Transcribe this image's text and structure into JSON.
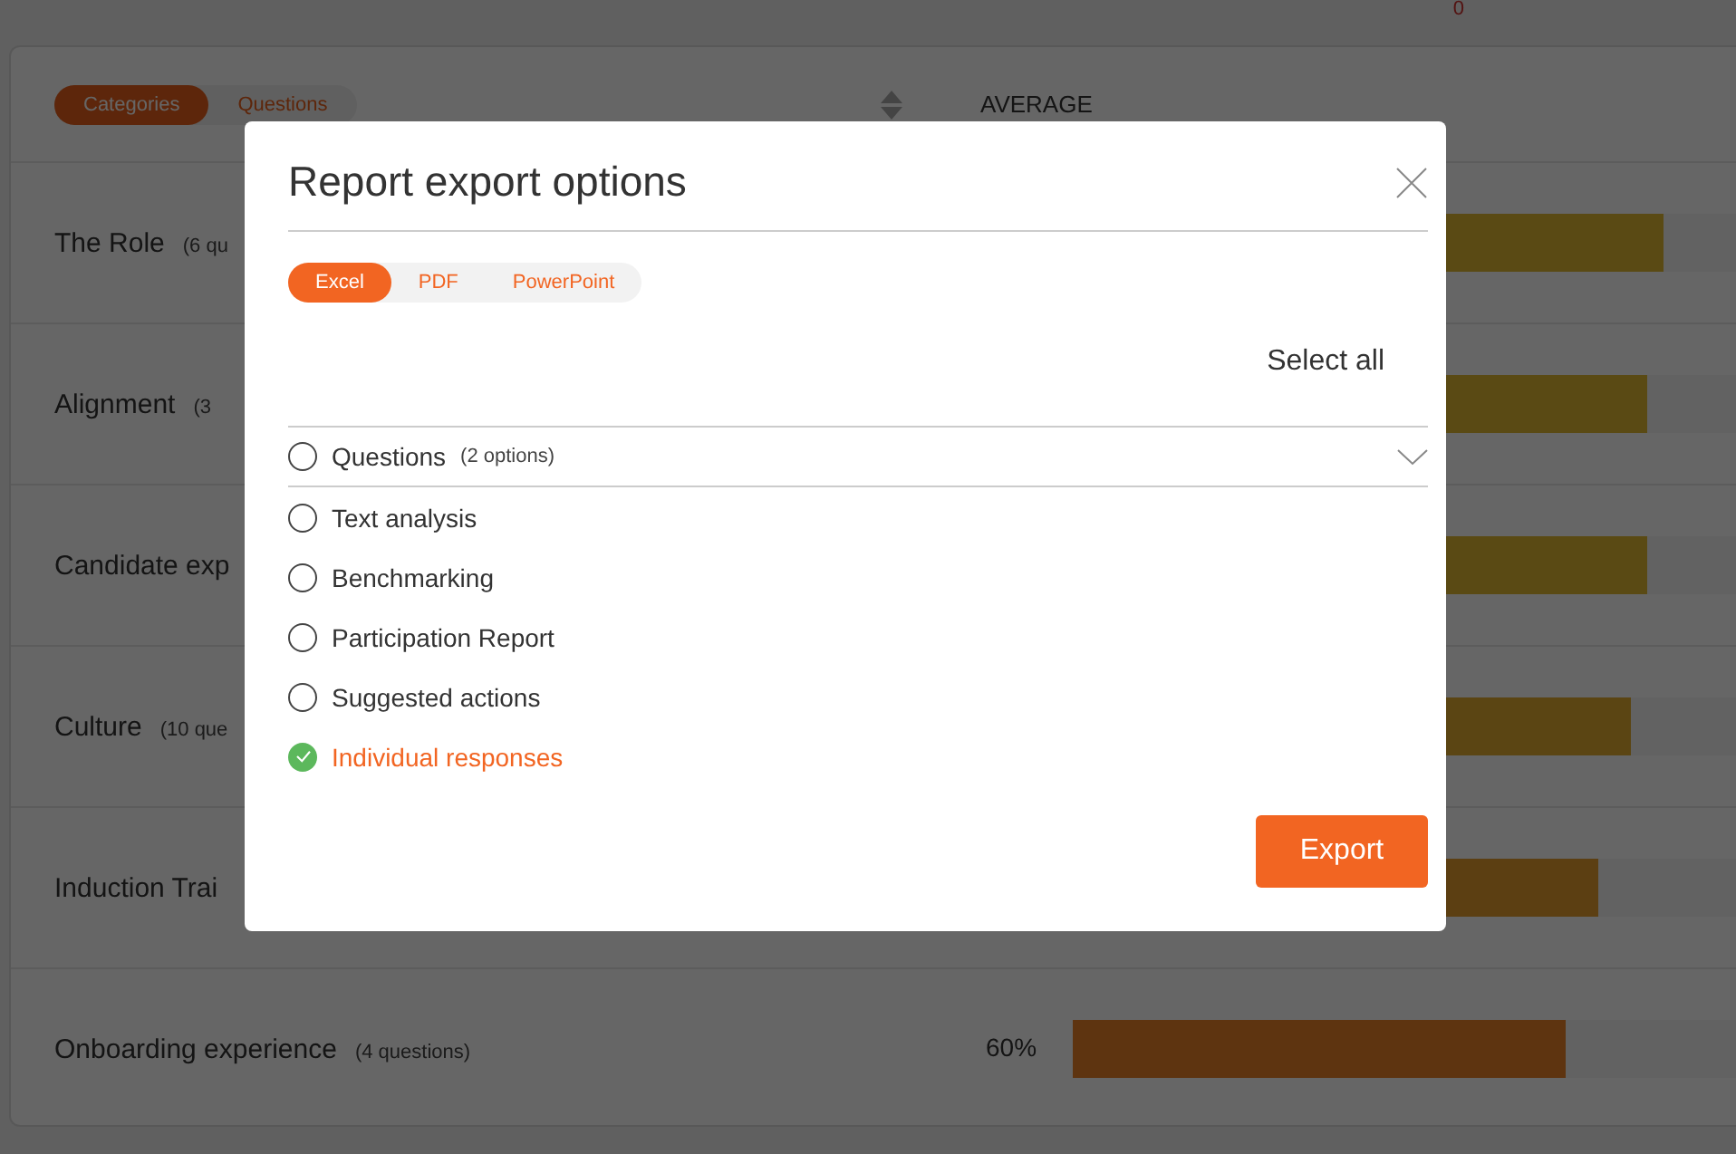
{
  "page": {
    "top_value": "0",
    "view_toggle": [
      {
        "label": "Categories",
        "selected": true
      },
      {
        "label": "Questions",
        "selected": false
      }
    ],
    "column_heading": "AVERAGE",
    "categories": [
      {
        "name": "The Role",
        "count": "(6 qu",
        "color": "#5a4a14",
        "level": 0.72
      },
      {
        "name": "Alignment",
        "count": "(3",
        "color": "#5a4a14",
        "level": 0.7
      },
      {
        "name": "Candidate exp",
        "color": "#5a4a14",
        "level": 0.7
      },
      {
        "name": "Culture",
        "count": "(10 que",
        "color": "#5b4513",
        "level": 0.68
      },
      {
        "name": "Induction Trai",
        "color": "#5c3f12",
        "level": 0.64
      },
      {
        "name": "Onboarding experience",
        "count": "(4 questions)",
        "reading": "60%",
        "color": "#5e3410",
        "level": 0.6
      }
    ]
  },
  "dialog": {
    "title": "Report export options",
    "formats": [
      {
        "label": "Excel",
        "selected": true
      },
      {
        "label": "PDF",
        "selected": false
      },
      {
        "label": "PowerPoint",
        "selected": false
      }
    ],
    "select_all": "Select all",
    "options": [
      {
        "label": "Questions",
        "note": "(2 options)",
        "kind": "expandable",
        "expanded": false,
        "checked": false
      },
      {
        "label": "Text analysis",
        "kind": "plain",
        "checked": false
      },
      {
        "label": "Benchmarking",
        "kind": "plain",
        "checked": false
      },
      {
        "label": "Participation Report",
        "kind": "plain",
        "checked": false
      },
      {
        "label": "Suggested actions",
        "kind": "plain",
        "checked": false
      },
      {
        "label": "Individual responses",
        "kind": "plain",
        "checked": true
      }
    ],
    "export_button": "Export"
  }
}
